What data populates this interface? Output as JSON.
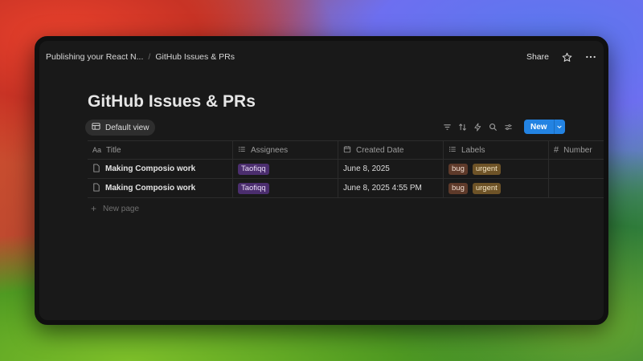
{
  "breadcrumb": {
    "parent": "Publishing your React N...",
    "current": "GitHub Issues & PRs"
  },
  "topbar": {
    "share_label": "Share"
  },
  "page": {
    "title": "GitHub Issues & PRs"
  },
  "view": {
    "label": "Default view"
  },
  "toolbar": {
    "new_label": "New"
  },
  "table": {
    "columns": [
      "Title",
      "Assignees",
      "Created Date",
      "Labels",
      "Number"
    ],
    "rows": [
      {
        "title": "Making Composio work",
        "assignee": "Taofiqq",
        "created": "June 8, 2025",
        "labels": [
          "bug",
          "urgent"
        ]
      },
      {
        "title": "Making Composio work",
        "assignee": "Taofiqq",
        "created": "June 8, 2025 4:55 PM",
        "labels": [
          "bug",
          "urgent"
        ]
      }
    ],
    "new_page_label": "New page"
  },
  "colors": {
    "accent": "#2383e2",
    "background": "#191919",
    "tag_person": "#4b2e6e",
    "tag_bug": "#5e3a2a",
    "tag_urgent": "#6e5327"
  },
  "icons": [
    "page-icon",
    "table-icon",
    "filter-icon",
    "sort-icon",
    "lightning-icon",
    "search-icon",
    "settings-sliders-icon",
    "star-icon",
    "more-icon",
    "chevron-down-icon",
    "plus-icon"
  ]
}
